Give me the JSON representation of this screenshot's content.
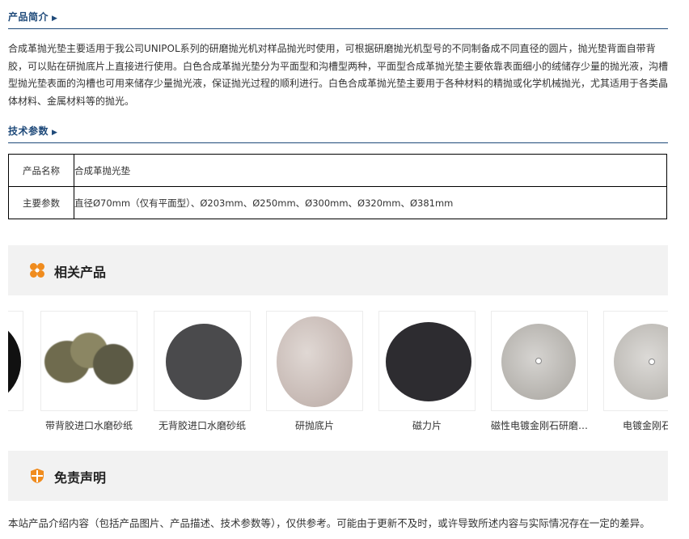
{
  "intro": {
    "heading": "产品简介",
    "arrow": "▶",
    "text": "合成革抛光垫主要适用于我公司UNIPOL系列的研磨抛光机对样品抛光时使用，可根据研磨抛光机型号的不同制备成不同直径的圆片，抛光垫背面自带背胶，可以贴在研抛底片上直接进行使用。白色合成革抛光垫分为平面型和沟槽型两种，平面型合成革抛光垫主要依靠表面细小的绒储存少量的抛光液，沟槽型抛光垫表面的沟槽也可用来储存少量抛光液，保证抛光过程的顺利进行。白色合成革抛光垫主要用于各种材料的精抛或化学机械抛光，尤其适用于各类晶体材料、金属材料等的抛光。"
  },
  "specs": {
    "heading": "技术参数",
    "arrow": "▶",
    "rows": [
      {
        "key": "产品名称",
        "value": "合成革抛光垫"
      },
      {
        "key": "主要参数",
        "value": "直径Ø70mm（仅有平面型）、Ø203mm、Ø250mm、Ø300mm、Ø320mm、Ø381mm"
      }
    ]
  },
  "related": {
    "title": "相关产品",
    "icon": "grid-flower-icon",
    "accent": "#f08c1e",
    "items": [
      {
        "name": "",
        "icon": "black-disc-partial"
      },
      {
        "name": "带背胶进口水磨砂纸",
        "icon": "sandpaper-discs"
      },
      {
        "name": "无背胶进口水磨砂纸",
        "icon": "gray-disc"
      },
      {
        "name": "研抛底片",
        "icon": "beige-disc"
      },
      {
        "name": "磁力片",
        "icon": "black-disc"
      },
      {
        "name": "磁性电镀金刚石研磨…",
        "icon": "silver-disc"
      },
      {
        "name": "电镀金刚石研",
        "icon": "silver-disc-partial"
      }
    ]
  },
  "disclaimer": {
    "title": "免责声明",
    "icon": "shield-icon",
    "text": "本站产品介绍内容（包括产品图片、产品描述、技术参数等），仅供参考。可能由于更新不及时，或许导致所述内容与实际情况存在一定的差异。"
  }
}
